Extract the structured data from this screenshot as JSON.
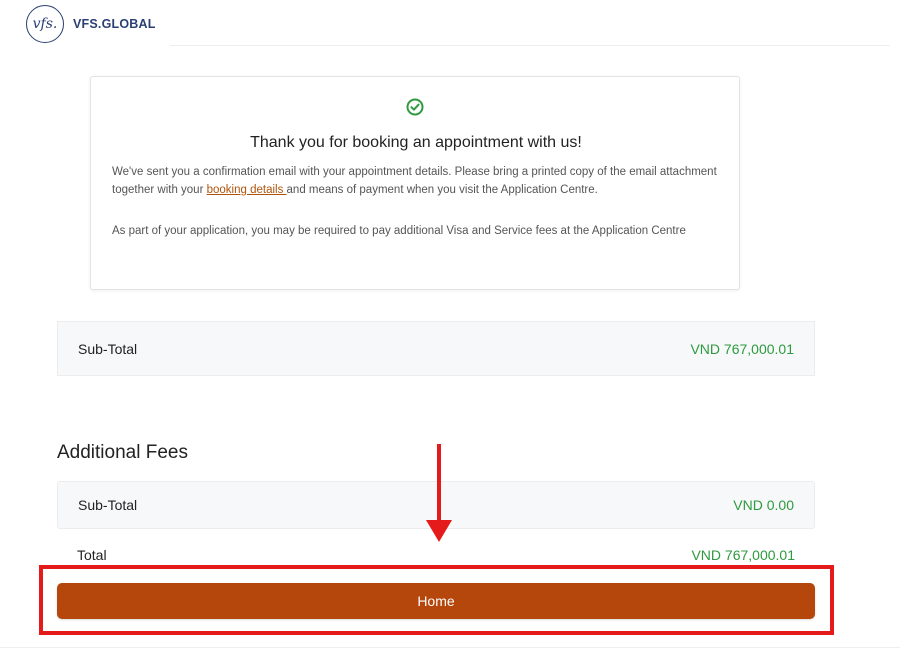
{
  "header": {
    "logo_mark": "vfs.",
    "brand": "VFS.GLOBAL"
  },
  "confirmation": {
    "icon": "check-circle-icon",
    "title": "Thank you for booking an appointment with us!",
    "paragraph1_before": "We've sent you a confirmation email with your appointment details. Please bring a printed copy of the email attachment together with your ",
    "paragraph1_link": "booking details ",
    "paragraph1_after": "and means of payment when you visit the Application Centre.",
    "paragraph2": "As part of your application, you may be required to pay additional Visa and Service fees at the Application Centre"
  },
  "summary": {
    "subtotal_label": "Sub-Total",
    "subtotal_value": "VND 767,000.01"
  },
  "additional_fees": {
    "heading": "Additional Fees",
    "subtotal_label": "Sub-Total",
    "subtotal_value": "VND 0.00"
  },
  "total": {
    "label": "Total",
    "value": "VND 767,000.01"
  },
  "home_button": {
    "label": "Home"
  },
  "colors": {
    "accent": "#b5460c",
    "amount_green": "#2e9a3f",
    "annotation_red": "#e51b1b",
    "brand_navy": "#2a3f73"
  }
}
